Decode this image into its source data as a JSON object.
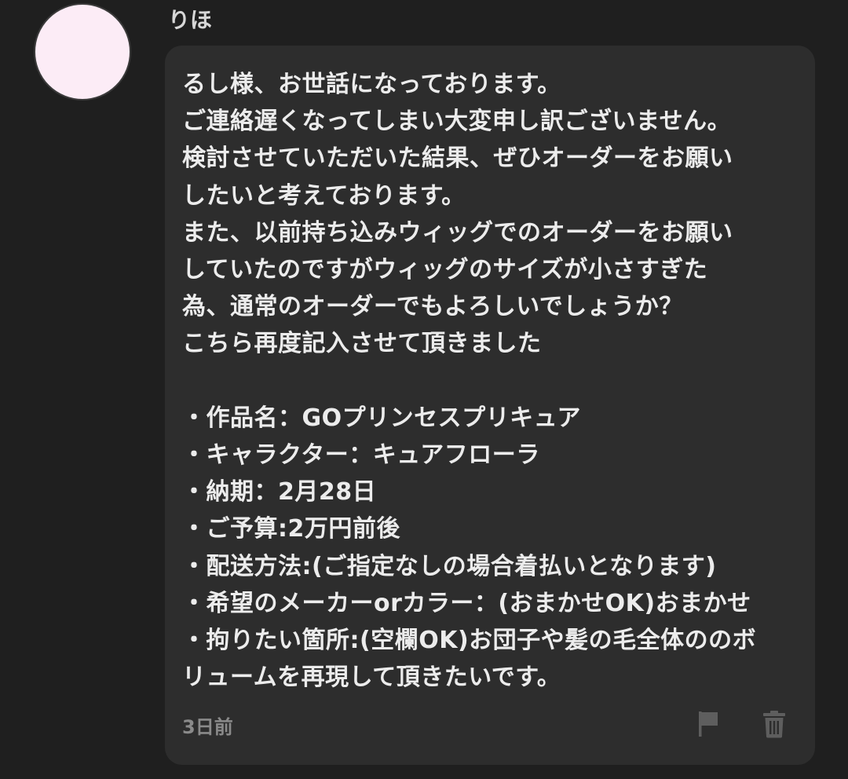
{
  "user": {
    "name": "りほ",
    "avatar_color": "#fcecf6"
  },
  "message": {
    "lines": [
      "るし様、お世話になっております。",
      "ご連絡遅くなってしまい大変申し訳ございません。",
      "検討させていただいた結果、ぜひオーダーをお願い",
      "したいと考えております。",
      "また、以前持ち込みウィッグでのオーダーをお願い",
      "していたのですがウィッグのサイズが小さすぎた",
      "為、通常のオーダーでもよろしいでしょうか？",
      "こちら再度記入させて頂きました",
      "",
      "・作品名：GOプリンセスプリキュア",
      "・キャラクター：キュアフローラ",
      "・納期：2月28日",
      "・ご予算:2万円前後",
      "・配送方法:(ご指定なしの場合着払いとなります)",
      "・希望のメーカーorカラー：(おまかせOK)おまかせ",
      "・拘りたい箇所:(空欄OK)お団子や髪の毛全体ののボ",
      "リュームを再現して頂きたいです。"
    ],
    "timestamp": "3日前"
  },
  "actions": {
    "flag_icon": "flag-icon",
    "delete_icon": "trash-icon"
  },
  "colors": {
    "background": "#1f1f1f",
    "bubble": "#2d2d2d",
    "text": "#ececec",
    "muted": "#8a8a8a"
  }
}
